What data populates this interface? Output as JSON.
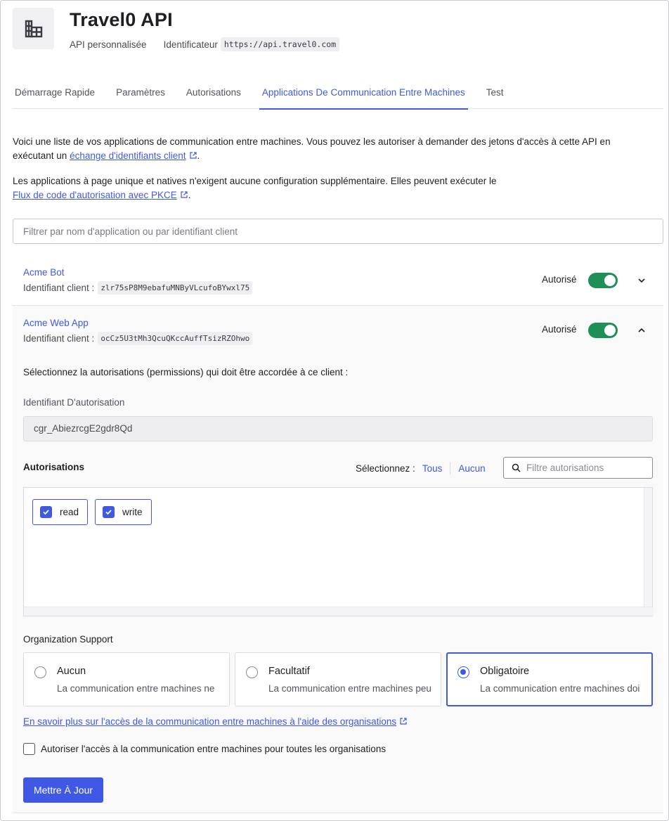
{
  "header": {
    "title": "Travel0 API",
    "api_type": "API personnalisée",
    "identifier_label": "Identificateur",
    "identifier_value": "https://api.travel0.com"
  },
  "tabs": [
    {
      "label": "Démarrage Rapide",
      "active": false
    },
    {
      "label": "Paramètres",
      "active": false
    },
    {
      "label": "Autorisations",
      "active": false
    },
    {
      "label": "Applications De Communication Entre Machines",
      "active": true
    },
    {
      "label": "Test",
      "active": false
    }
  ],
  "description": {
    "p1_text": "Voici une liste de vos applications de communication entre machines. Vous pouvez les autoriser à demander des jetons d'accès à cette API en exécutant un ",
    "p1_link": "échange d'identifiants client",
    "p1_end": ".",
    "p2_text": "Les applications à page unique et natives n'exigent aucune configuration supplémentaire. Elles peuvent exécuter le",
    "p2_link": "Flux de code d'autorisation avec PKCE",
    "p2_end": "."
  },
  "filter": {
    "placeholder": "Filtrer par nom d'application ou par identifiant client"
  },
  "apps": [
    {
      "name": "Acme Bot",
      "client_label": "Identifiant client :",
      "client_id": "zlr75sP8M9ebafuMNByVLcufoBYwxl75",
      "status": "Autorisé",
      "authorized": true,
      "expanded": false
    },
    {
      "name": "Acme Web App",
      "client_label": "Identifiant client :",
      "client_id": "ocCz5U3tMh3QcuQKccAuffTsizRZOhwo",
      "status": "Autorisé",
      "authorized": true,
      "expanded": true
    }
  ],
  "detail": {
    "instruction": "Sélectionnez la autorisations (permissions) qui doit être accordée à ce client :",
    "grant_label": "Identifiant D'autorisation",
    "grant_id": "cgr_AbiezrcgE2gdr8Qd",
    "permissions_label": "Autorisations",
    "select_label": "Sélectionnez :",
    "select_all": "Tous",
    "select_none": "Aucun",
    "permission_filter_placeholder": "Filtre autorisations",
    "permissions": [
      {
        "name": "read",
        "checked": true
      },
      {
        "name": "write",
        "checked": true
      }
    ],
    "org_support_label": "Organization Support",
    "org_options": [
      {
        "title": "Aucun",
        "desc": "La communication entre machines ne",
        "selected": false
      },
      {
        "title": "Facultatif",
        "desc": "La communication entre machines peu",
        "selected": false
      },
      {
        "title": "Obligatoire",
        "desc": "La communication entre machines doi",
        "selected": true
      }
    ],
    "learn_more": "En savoir plus sur l'accès de la communication entre machines à l'aide des organisations",
    "allow_all_orgs": "Autoriser l'accès à la communication entre machines pour toutes les organisations",
    "update_button": "Mettre À Jour"
  },
  "colors": {
    "accent": "#3f59e4",
    "toggle_on": "#1f8f58"
  },
  "icons": {
    "api": "building-icon",
    "external": "external-link-icon",
    "chevron_down": "chevron-down-icon",
    "chevron_up": "chevron-up-icon",
    "search": "search-icon",
    "check": "check-icon"
  }
}
